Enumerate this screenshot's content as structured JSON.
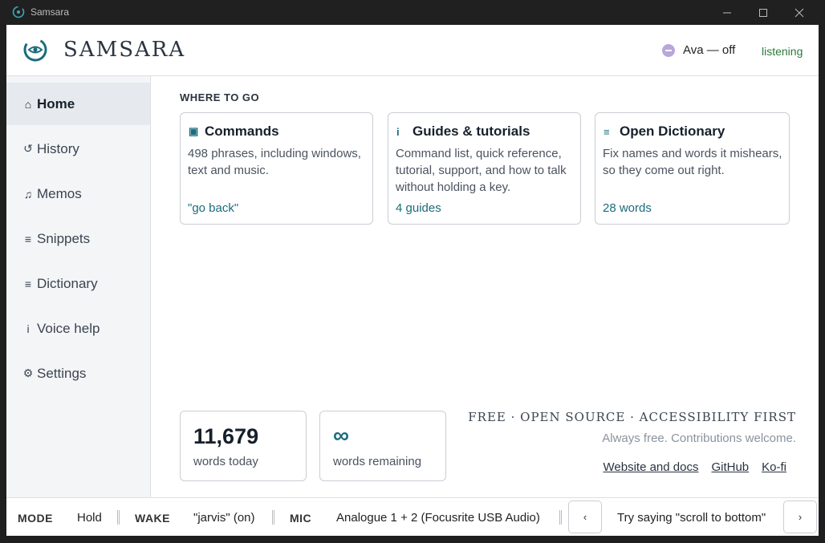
{
  "window": {
    "title": "Samsara"
  },
  "header": {
    "brand": "SAMSARA",
    "assistant_status": "Ava — off",
    "listening_status": "listening"
  },
  "sidebar": {
    "items": [
      {
        "icon": "home-icon",
        "glyph": "⌂",
        "label": "Home",
        "active": true
      },
      {
        "icon": "history-icon",
        "glyph": "↺",
        "label": "History"
      },
      {
        "icon": "music-note-icon",
        "glyph": "♫",
        "label": "Memos"
      },
      {
        "icon": "list-icon",
        "glyph": "≡",
        "label": "Snippets"
      },
      {
        "icon": "list-icon",
        "glyph": "≡",
        "label": "Dictionary"
      },
      {
        "icon": "info-icon",
        "glyph": "i",
        "label": "Voice help"
      },
      {
        "icon": "gear-icon",
        "glyph": "⚙",
        "label": "Settings"
      }
    ]
  },
  "main": {
    "section_label": "WHERE TO GO",
    "cards": [
      {
        "icon": "square-icon",
        "glyph": "▣",
        "title": "Commands",
        "description": "498 phrases, including windows, text and music.",
        "link": "\"go back\""
      },
      {
        "icon": "info-icon",
        "glyph": "i",
        "title": "Guides & tutorials",
        "description": "Command list, quick reference, tutorial, support, and how to talk without holding a key.",
        "link": "4 guides"
      },
      {
        "icon": "list-icon",
        "glyph": "≡",
        "title": "Open Dictionary",
        "description": "Fix names and words it mishears, so they come out right.",
        "link": "28 words"
      }
    ],
    "stats": [
      {
        "value": "11,679",
        "label": "words today"
      },
      {
        "value": "∞",
        "label": "words remaining"
      }
    ],
    "tagline": "FREE · OPEN SOURCE · ACCESSIBILITY FIRST",
    "subline": "Always free. Contributions welcome.",
    "links": [
      "Website and docs",
      "GitHub",
      "Ko-fi"
    ]
  },
  "statusbar": {
    "mode_key": "MODE",
    "mode_value": "Hold",
    "wake_key": "WAKE",
    "wake_value": "\"jarvis\" (on)",
    "mic_key": "MIC",
    "mic_value": "Analogue 1 + 2 (Focusrite USB Audio)",
    "prev_glyph": "‹",
    "hint": "Try saying \"scroll to bottom\"",
    "next_glyph": "›"
  },
  "colors": {
    "accent": "#1a6c7d",
    "listening": "#2b7a3a",
    "status_dot": "#b8a7d8"
  }
}
